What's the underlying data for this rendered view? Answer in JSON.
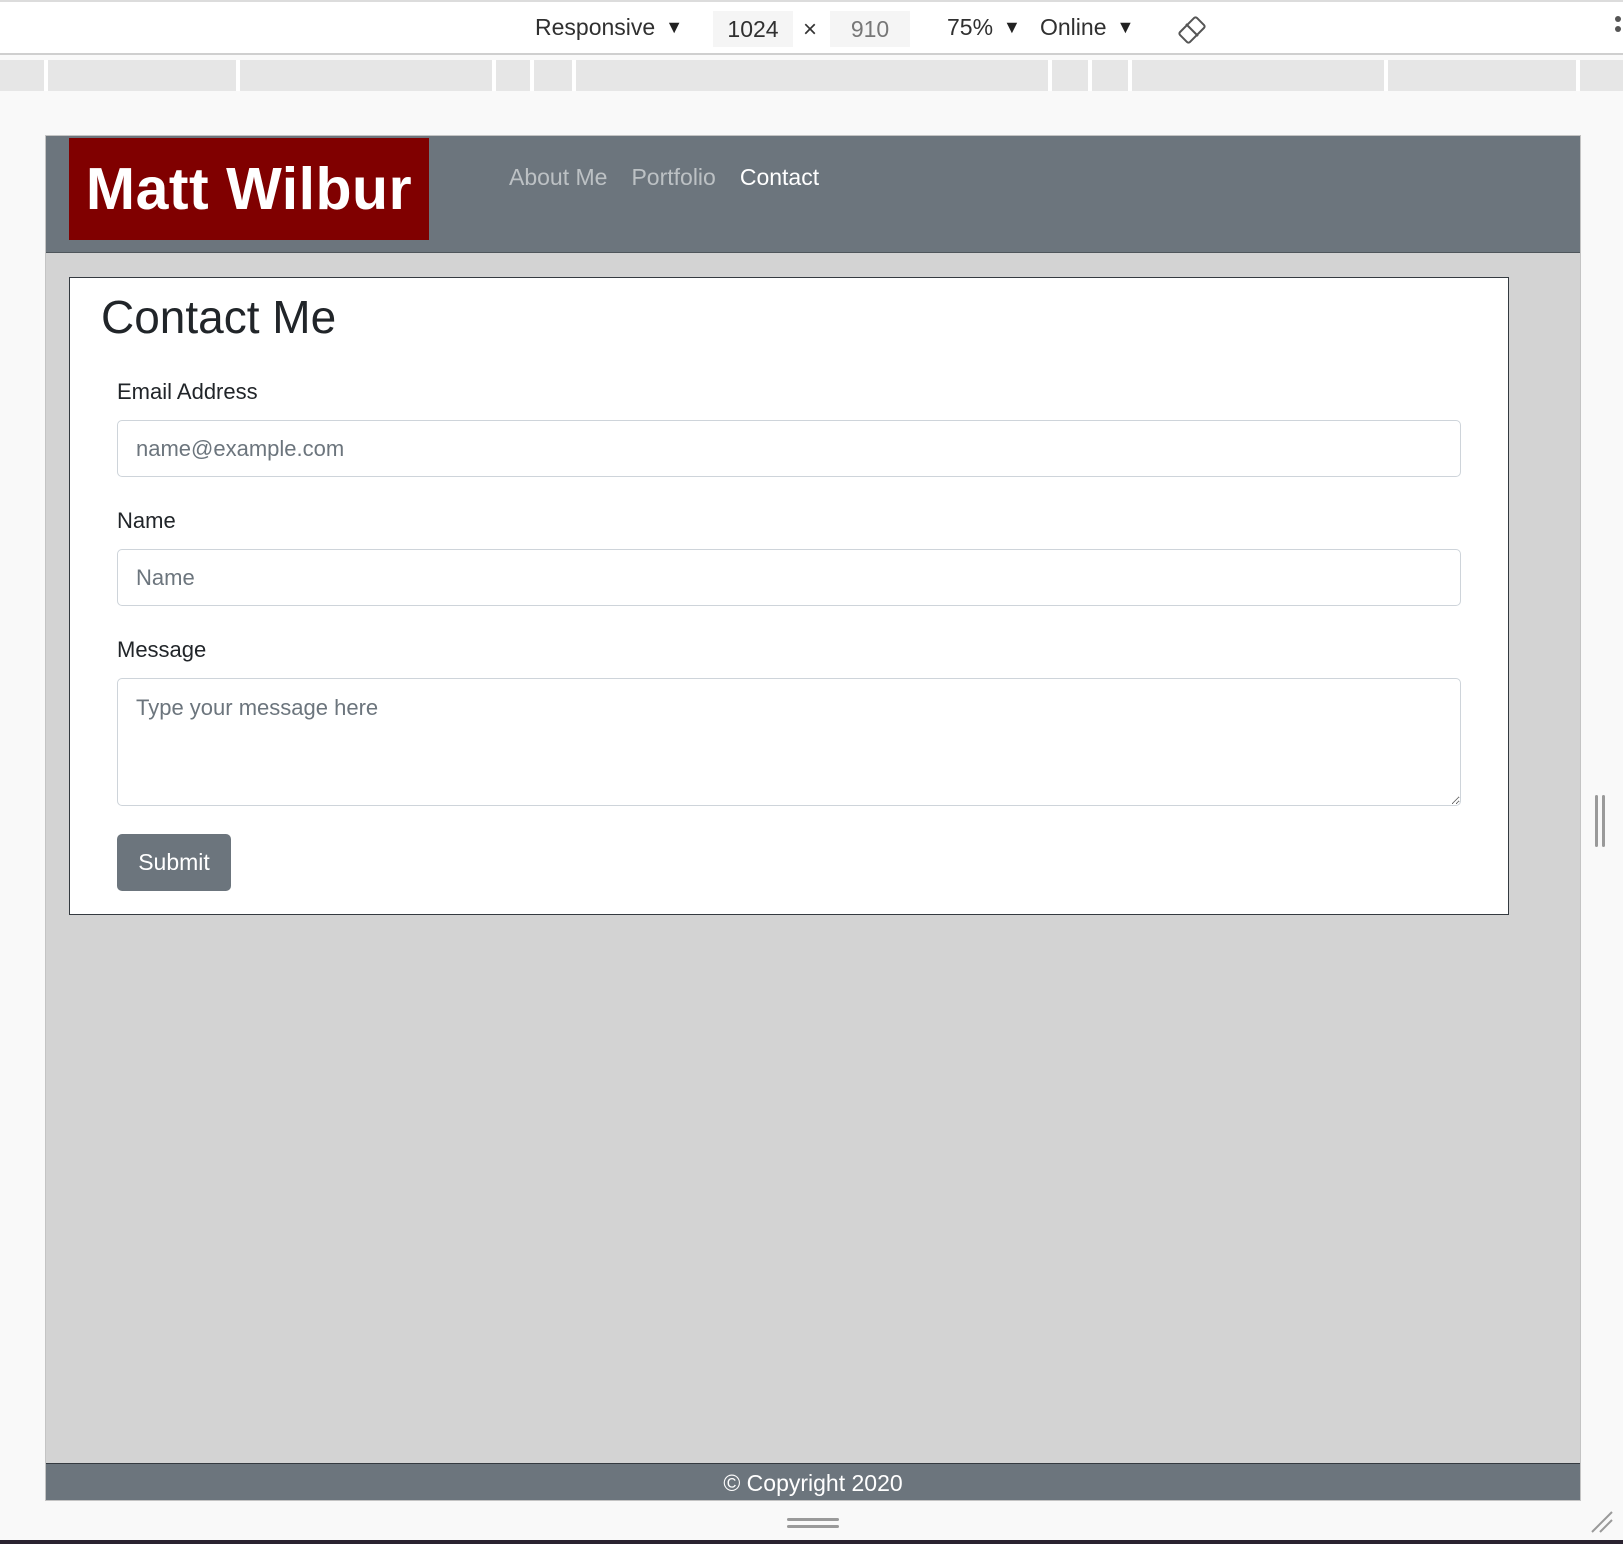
{
  "devtools": {
    "device_mode": "Responsive",
    "width_value": "1024",
    "height_value": "910",
    "times": "×",
    "zoom": "75%",
    "network": "Online",
    "caret": "▼"
  },
  "site": {
    "brand": "Matt Wilbur",
    "nav": [
      {
        "label": "About Me",
        "active": false
      },
      {
        "label": "Portfolio",
        "active": false
      },
      {
        "label": "Contact",
        "active": true
      }
    ],
    "brand_color": "#800000",
    "header_color": "#6c757d"
  },
  "contact": {
    "title": "Contact Me",
    "email_label": "Email Address",
    "email_placeholder": "name@example.com",
    "name_label": "Name",
    "name_placeholder": "Name",
    "message_label": "Message",
    "message_placeholder": "Type your message here",
    "submit_label": "Submit"
  },
  "footer": {
    "text": "© Copyright 2020"
  }
}
